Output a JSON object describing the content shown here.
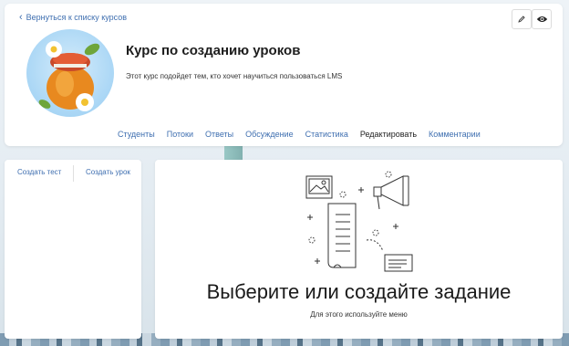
{
  "header": {
    "back_link": "Вернуться к списку курсов",
    "edit_icon": "pencil-icon",
    "view_icon": "eye-icon"
  },
  "course": {
    "title": "Курс по созданию уроков",
    "description": "Этот курс подойдет тем, кто хочет научиться пользоваться LMS"
  },
  "tabs": [
    {
      "label": "Студенты"
    },
    {
      "label": "Потоки"
    },
    {
      "label": "Ответы"
    },
    {
      "label": "Обсуждение"
    },
    {
      "label": "Статистика"
    },
    {
      "label": "Редактировать",
      "active": true
    },
    {
      "label": "Комментарии"
    }
  ],
  "menu": {
    "create_test": "Создать тест",
    "create_lesson": "Создать урок"
  },
  "empty_state": {
    "title": "Выберите или создайте задание",
    "hint": "Для этого используйте меню",
    "icon": "documents-megaphone-illustration"
  },
  "colors": {
    "link": "#3f6fb0",
    "text": "#222222",
    "card": "#ffffff"
  }
}
